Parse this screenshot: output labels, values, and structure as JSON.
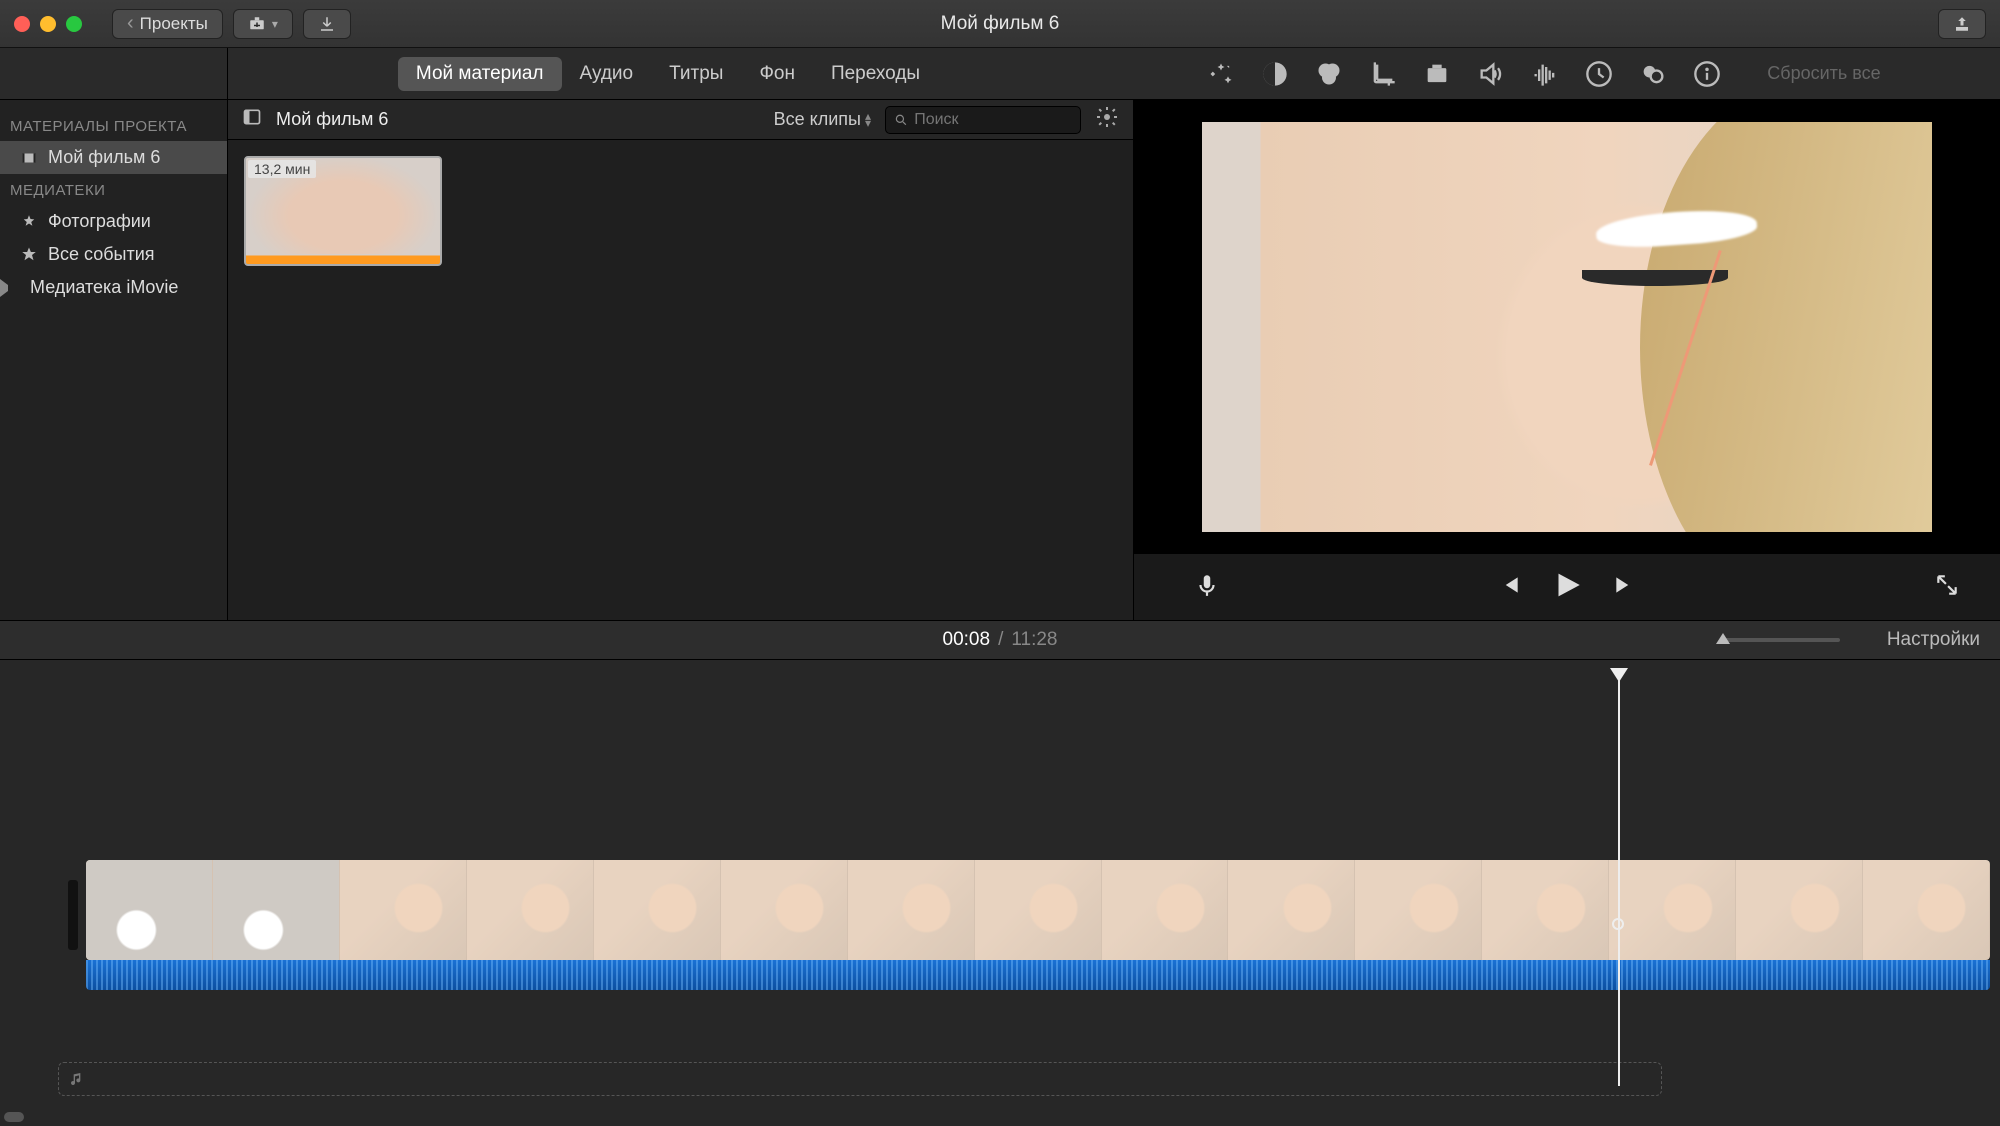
{
  "titlebar": {
    "projects_btn": "Проекты",
    "title": "Мой фильм 6"
  },
  "tabs": {
    "items": [
      "Мой материал",
      "Аудио",
      "Титры",
      "Фон",
      "Переходы"
    ],
    "active_index": 0,
    "reset": "Сбросить все"
  },
  "sidebar": {
    "heading_projects": "МАТЕРИАЛЫ ПРОЕКТА",
    "project_name": "Мой фильм 6",
    "heading_libs": "МЕДИАТЕКИ",
    "photos": "Фотографии",
    "all_events": "Все события",
    "imovie_lib": "Медиатека iMovie"
  },
  "browser": {
    "title": "Мой фильм 6",
    "filter": "Все клипы",
    "search_placeholder": "Поиск",
    "clip_duration": "13,2 мин"
  },
  "playback": {
    "current": "00:08",
    "sep": "/",
    "total": "11:28",
    "settings": "Настройки"
  }
}
